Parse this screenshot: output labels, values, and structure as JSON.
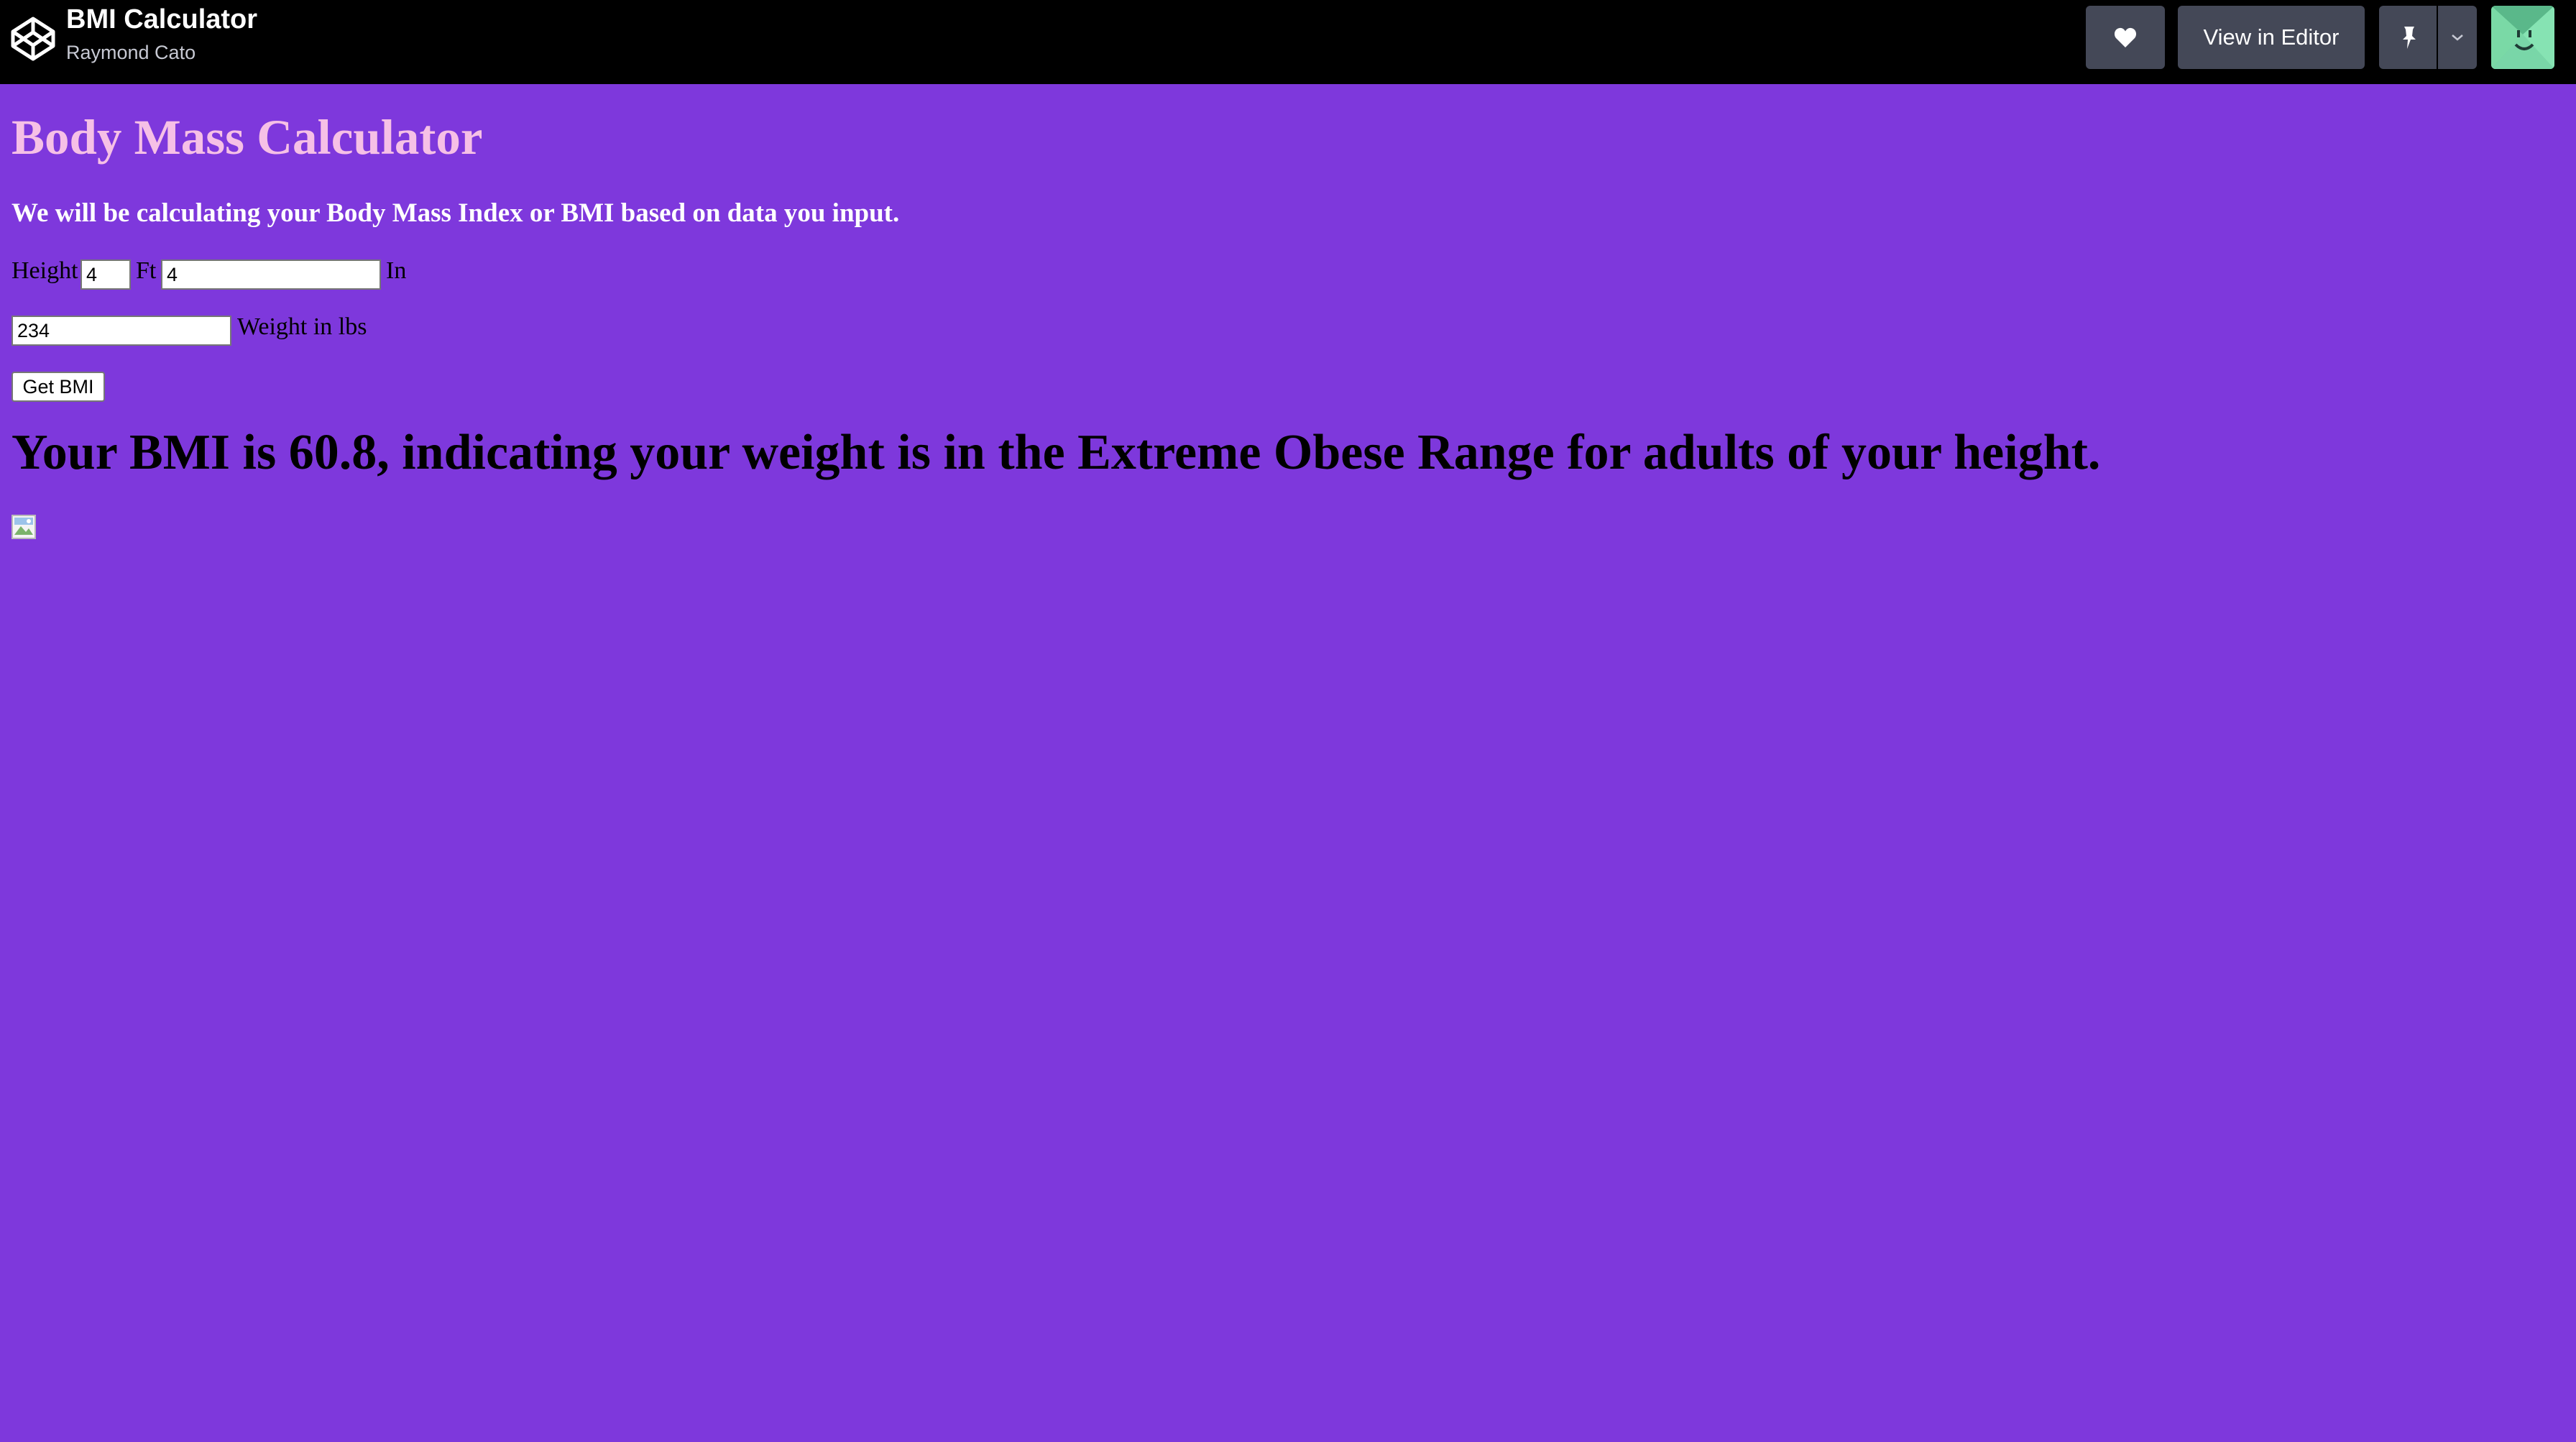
{
  "header": {
    "pen_title": "BMI Calculator",
    "author": "Raymond Cato",
    "view_in_editor_label": "View in Editor",
    "icons": {
      "logo": "codepen-logo-icon",
      "heart": "heart-icon",
      "pin": "pin-icon",
      "dropdown": "chevron-down-icon",
      "avatar": "user-avatar"
    }
  },
  "page": {
    "background": "#7e38dc",
    "heading": "Body Mass Calculator",
    "heading_color": "#f6c0e6",
    "intro": "We will be calculating your Body Mass Index or BMI based on data you input.",
    "height_label": "Height",
    "feet_value": "4",
    "feet_unit": "Ft",
    "inches_value": "4",
    "inches_unit": "In",
    "weight_value": "234",
    "weight_label": "Weight in lbs",
    "button_label": "Get BMI",
    "result": "Your BMI is 60.8, indicating your weight is in the Extreme Obese Range for adults of your height."
  }
}
